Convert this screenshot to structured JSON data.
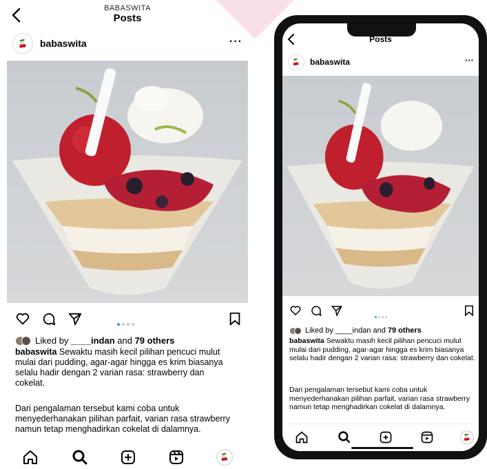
{
  "header": {
    "account": "BABASWITA",
    "title": "Posts"
  },
  "post": {
    "username": "babaswita",
    "more": "···",
    "avatar_text": "🍒",
    "likes_prefix": "Liked by ",
    "likes_user": "____indan",
    "likes_and": " and ",
    "likes_others": "79 others",
    "caption_user": "babaswita",
    "caption_text": " Sewaktu masih kecil pilihan pencuci mulut mulai dari pudding, agar-agar hingga es krim biasanya selalu hadir dengan 2 varian rasa: strawberry dan cokelat.",
    "caption_paragraph2": "Dari pengalaman tersebut kami coba untuk menyederhanakan pilihan parfait, varian rasa strawberry namun tetap menghadirkan cokelat di dalamnya.",
    "carousel": {
      "count": 4,
      "active": 0
    }
  },
  "icons": {
    "back": "chevron-left-icon",
    "like": "heart-icon",
    "comment": "comment-icon",
    "share": "send-icon",
    "save": "bookmark-icon",
    "nav": [
      "home-icon",
      "search-icon",
      "add-post-icon",
      "reels-icon",
      "profile-avatar"
    ]
  },
  "colors": {
    "accent": "#3897f0",
    "brand": "#b0273c"
  }
}
